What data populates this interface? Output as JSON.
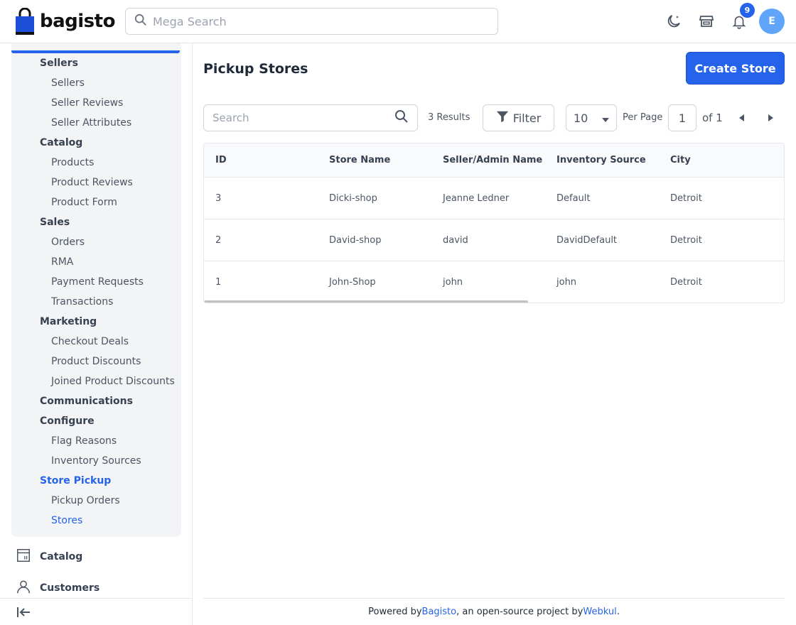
{
  "header": {
    "logo_text": "bagisto",
    "search_placeholder": "Mega Search",
    "notification_count": "9",
    "avatar_initial": "E",
    "colors": {
      "accent": "#2563eb",
      "avatar": "#60a5fa"
    }
  },
  "sidebar": {
    "items": [
      {
        "label": "Sellers",
        "level": 1
      },
      {
        "label": "Sellers",
        "level": 2
      },
      {
        "label": "Seller Reviews",
        "level": 2
      },
      {
        "label": "Seller Attributes",
        "level": 2
      },
      {
        "label": "Catalog",
        "level": 1
      },
      {
        "label": "Products",
        "level": 2
      },
      {
        "label": "Product Reviews",
        "level": 2
      },
      {
        "label": "Product Form",
        "level": 2
      },
      {
        "label": "Sales",
        "level": 1
      },
      {
        "label": "Orders",
        "level": 2
      },
      {
        "label": "RMA",
        "level": 2
      },
      {
        "label": "Payment Requests",
        "level": 2
      },
      {
        "label": "Transactions",
        "level": 2
      },
      {
        "label": "Marketing",
        "level": 1
      },
      {
        "label": "Checkout Deals",
        "level": 2
      },
      {
        "label": "Product Discounts",
        "level": 2
      },
      {
        "label": "Joined Product Discounts",
        "level": 2
      },
      {
        "label": "Communications",
        "level": 1
      },
      {
        "label": "Configure",
        "level": 1
      },
      {
        "label": "Flag Reasons",
        "level": 2
      },
      {
        "label": "Inventory Sources",
        "level": 2
      },
      {
        "label": "Store Pickup",
        "level": 1,
        "active": true
      },
      {
        "label": "Pickup Orders",
        "level": 2
      },
      {
        "label": "Stores",
        "level": 2,
        "active": true
      }
    ],
    "main_nav": [
      {
        "label": "Catalog",
        "icon": "catalog-icon"
      },
      {
        "label": "Customers",
        "icon": "customers-icon"
      }
    ]
  },
  "main": {
    "title": "Pickup Stores",
    "create_button": "Create Store",
    "search_placeholder": "Search",
    "results": "3 Results",
    "filter_label": "Filter",
    "per_page_value": "10",
    "per_page_label": "Per Page",
    "page_value": "1",
    "page_of": "of 1",
    "columns": [
      "ID",
      "Store Name",
      "Seller/Admin Name",
      "Inventory Source",
      "City"
    ],
    "rows": [
      [
        "3",
        "Dicki-shop",
        "Jeanne Ledner",
        "Default",
        "Detroit"
      ],
      [
        "2",
        "David-shop",
        "david",
        "DavidDefault",
        "Detroit"
      ],
      [
        "1",
        "John-Shop",
        "john",
        "john",
        "Detroit"
      ]
    ]
  },
  "footer": {
    "prefix": "Powered by ",
    "link1": "Bagisto",
    "middle": ", an open-source project by ",
    "link2": "Webkul",
    "suffix": "."
  }
}
